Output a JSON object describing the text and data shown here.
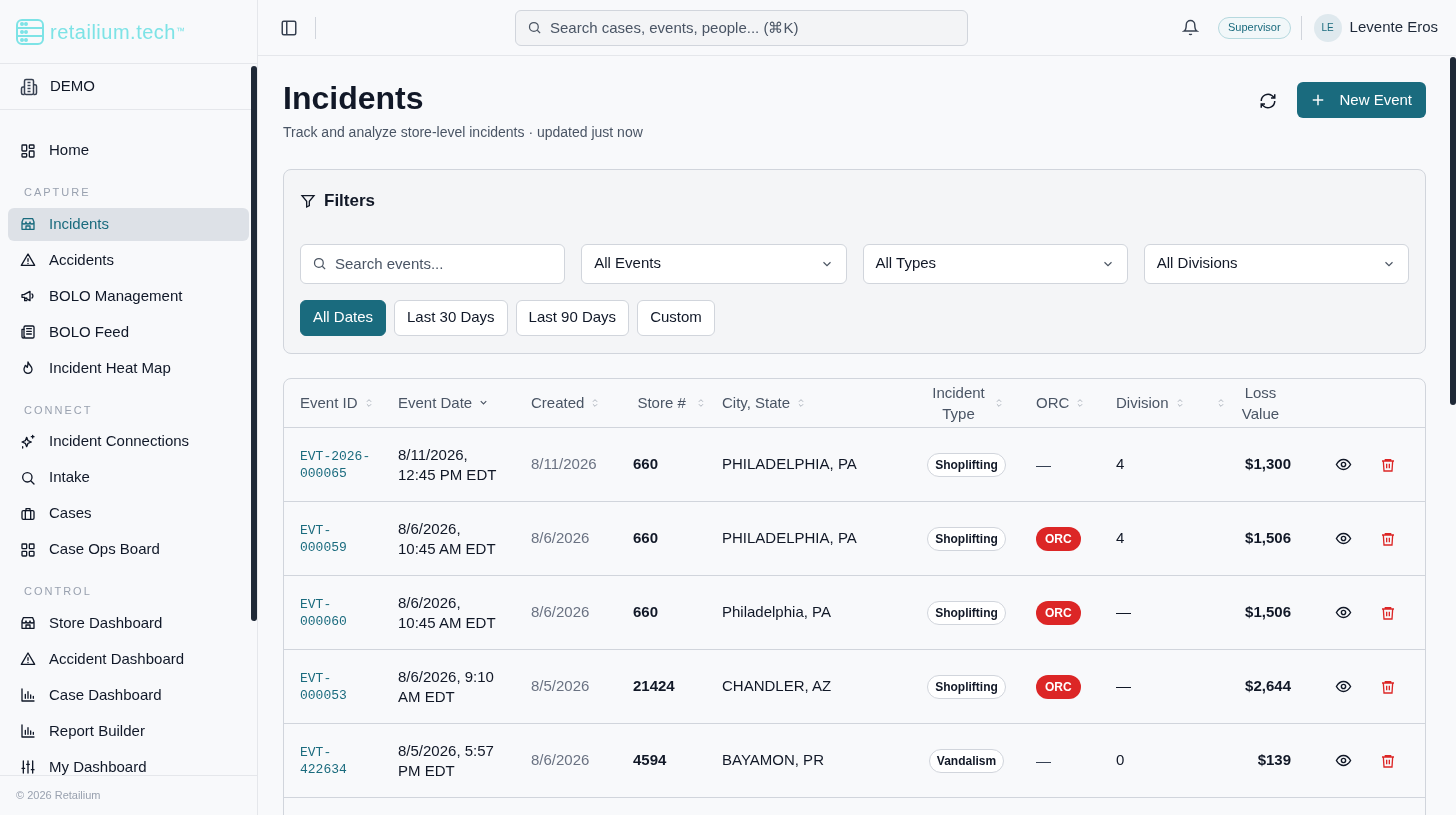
{
  "brand": {
    "name": "retailium.tech",
    "mark": "™"
  },
  "header": {
    "search_placeholder": "Search cases, events, people... (⌘K)",
    "role": "Supervisor",
    "user": {
      "initials": "LE",
      "name": "Levente Eros"
    }
  },
  "sidebar": {
    "org": "DEMO",
    "sections": [
      {
        "items": [
          {
            "label": "Home",
            "selected": false
          }
        ]
      },
      {
        "heading": "CAPTURE",
        "items": [
          {
            "label": "Incidents",
            "selected": true
          },
          {
            "label": "Accidents",
            "selected": false
          },
          {
            "label": "BOLO Management",
            "selected": false
          },
          {
            "label": "BOLO Feed",
            "selected": false
          },
          {
            "label": "Incident Heat Map",
            "selected": false
          }
        ]
      },
      {
        "heading": "CONNECT",
        "items": [
          {
            "label": "Incident Connections",
            "selected": false
          },
          {
            "label": "Intake",
            "selected": false
          },
          {
            "label": "Cases",
            "selected": false
          },
          {
            "label": "Case Ops Board",
            "selected": false
          }
        ]
      },
      {
        "heading": "CONTROL",
        "items": [
          {
            "label": "Store Dashboard",
            "selected": false
          },
          {
            "label": "Accident Dashboard",
            "selected": false
          },
          {
            "label": "Case Dashboard",
            "selected": false
          },
          {
            "label": "Report Builder",
            "selected": false
          },
          {
            "label": "My Dashboard",
            "selected": false
          }
        ]
      }
    ],
    "footer": "© 2026 Retailium"
  },
  "page": {
    "title": "Incidents",
    "subtitle": "Track and analyze store-level incidents · updated just now",
    "new_button": "New Event"
  },
  "filters": {
    "title": "Filters",
    "search_placeholder": "Search events...",
    "selects": [
      "All Events",
      "All Types",
      "All Divisions"
    ],
    "date_ranges": [
      {
        "label": "All Dates",
        "selected": true
      },
      {
        "label": "Last 30 Days",
        "selected": false
      },
      {
        "label": "Last 90 Days",
        "selected": false
      },
      {
        "label": "Custom",
        "selected": false
      }
    ]
  },
  "table": {
    "columns": [
      {
        "label": "Event ID",
        "sorted": false
      },
      {
        "label": "Event Date",
        "sorted": true
      },
      {
        "label": "Created",
        "sorted": false
      },
      {
        "label": "Store #",
        "sorted": false
      },
      {
        "label": "City, State",
        "sorted": false
      },
      {
        "label": "Incident Type",
        "sorted": false
      },
      {
        "label": "ORC",
        "sorted": false
      },
      {
        "label": "Division",
        "sorted": false
      },
      {
        "label": "Loss Value",
        "sorted": false
      }
    ],
    "rows": [
      {
        "event_id": "EVT-2026-000065",
        "event_date": "8/11/2026, 12:45 PM EDT",
        "created": "8/11/2026",
        "store": "660",
        "city_state": "PHILADELPHIA, PA",
        "incident_type": "Shoplifting",
        "orc": "—",
        "orc_flagged": false,
        "division": "4",
        "loss_value": "$1,300"
      },
      {
        "event_id": "EVT-000059",
        "event_date": "8/6/2026, 10:45 AM EDT",
        "created": "8/6/2026",
        "store": "660",
        "city_state": "PHILADELPHIA, PA",
        "incident_type": "Shoplifting",
        "orc": "ORC",
        "orc_flagged": true,
        "division": "4",
        "loss_value": "$1,506"
      },
      {
        "event_id": "EVT-000060",
        "event_date": "8/6/2026, 10:45 AM EDT",
        "created": "8/6/2026",
        "store": "660",
        "city_state": "Philadelphia, PA",
        "incident_type": "Shoplifting",
        "orc": "ORC",
        "orc_flagged": true,
        "division": "—",
        "loss_value": "$1,506"
      },
      {
        "event_id": "EVT-000053",
        "event_date": "8/6/2026, 9:10 AM EDT",
        "created": "8/5/2026",
        "store": "21424",
        "city_state": "CHANDLER, AZ",
        "incident_type": "Shoplifting",
        "orc": "ORC",
        "orc_flagged": true,
        "division": "—",
        "loss_value": "$2,644"
      },
      {
        "event_id": "EVT-422634",
        "event_date": "8/5/2026, 5:57 PM EDT",
        "created": "8/6/2026",
        "store": "4594",
        "city_state": "BAYAMON, PR",
        "incident_type": "Vandalism",
        "orc": "—",
        "orc_flagged": false,
        "division": "0",
        "loss_value": "$139"
      }
    ]
  }
}
